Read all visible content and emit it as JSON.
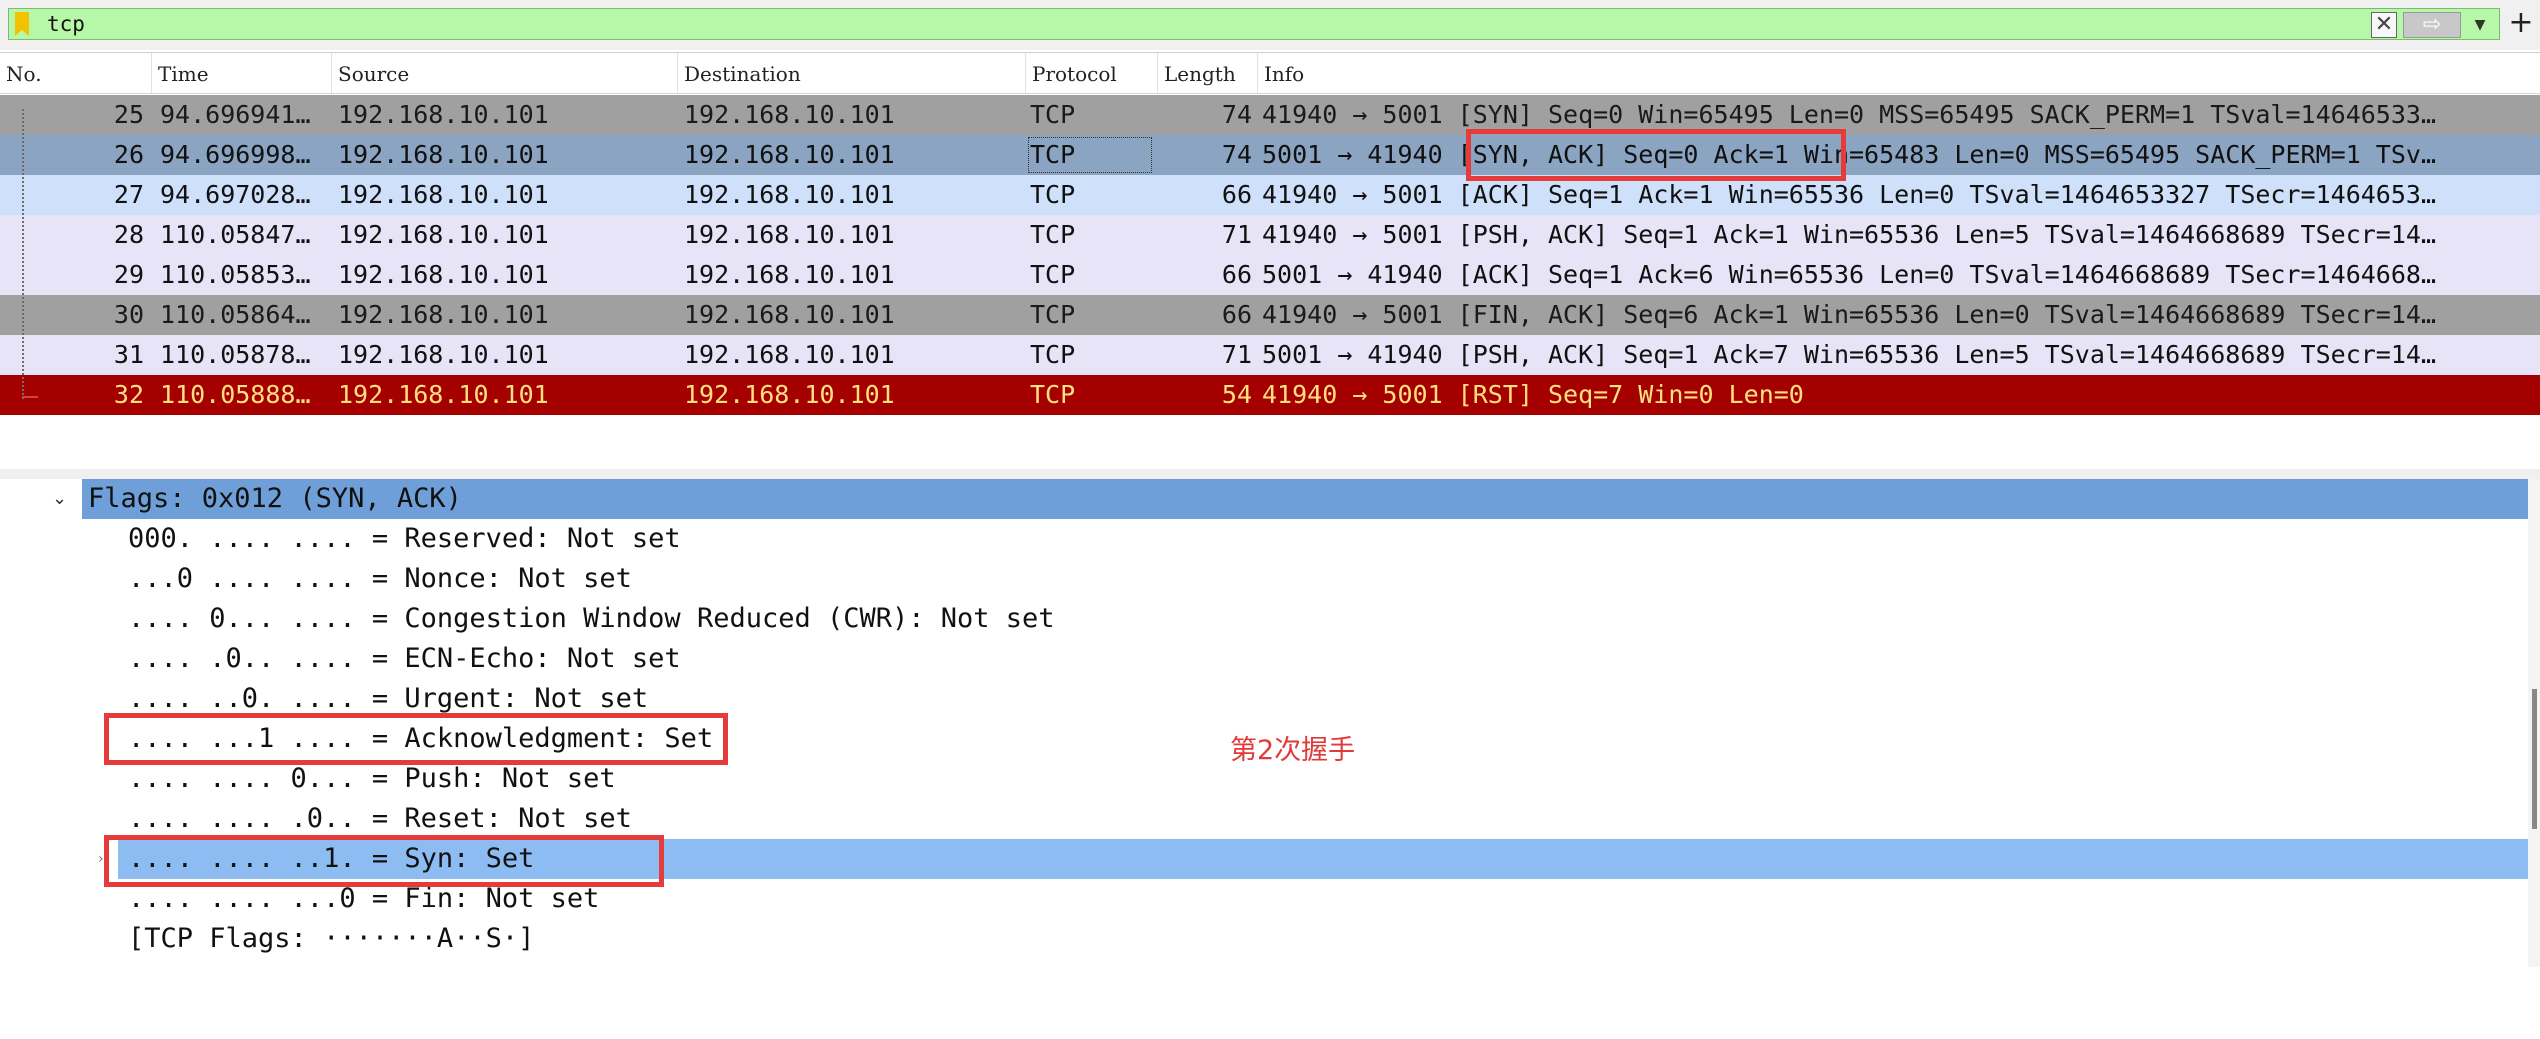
{
  "filter": {
    "value": "tcp",
    "clear_icon": "clear-icon",
    "apply_icon": "arrow-right-icon",
    "dropdown_icon": "chevron-down-icon",
    "add_icon": "plus-icon"
  },
  "columns": [
    "No.",
    "Time",
    "Source",
    "Destination",
    "Protocol",
    "Length",
    "Info"
  ],
  "packets": [
    {
      "no": "25",
      "time": "94.696941…",
      "src": "192.168.10.101",
      "dst": "192.168.10.101",
      "proto": "TCP",
      "len": "74",
      "info": "41940 → 5001 [SYN] Seq=0 Win=65495 Len=0 MSS=65495 SACK_PERM=1 TSval=14646533…"
    },
    {
      "no": "26",
      "time": "94.696998…",
      "src": "192.168.10.101",
      "dst": "192.168.10.101",
      "proto": "TCP",
      "len": "74",
      "info": "5001 → 41940 [SYN, ACK] Seq=0 Ack=1 Win=65483 Len=0 MSS=65495 SACK_PERM=1 TSv…"
    },
    {
      "no": "27",
      "time": "94.697028…",
      "src": "192.168.10.101",
      "dst": "192.168.10.101",
      "proto": "TCP",
      "len": "66",
      "info": "41940 → 5001 [ACK] Seq=1 Ack=1 Win=65536 Len=0 TSval=1464653327 TSecr=1464653…"
    },
    {
      "no": "28",
      "time": "110.05847…",
      "src": "192.168.10.101",
      "dst": "192.168.10.101",
      "proto": "TCP",
      "len": "71",
      "info": "41940 → 5001 [PSH, ACK] Seq=1 Ack=1 Win=65536 Len=5 TSval=1464668689 TSecr=14…"
    },
    {
      "no": "29",
      "time": "110.05853…",
      "src": "192.168.10.101",
      "dst": "192.168.10.101",
      "proto": "TCP",
      "len": "66",
      "info": "5001 → 41940 [ACK] Seq=1 Ack=6 Win=65536 Len=0 TSval=1464668689 TSecr=1464668…"
    },
    {
      "no": "30",
      "time": "110.05864…",
      "src": "192.168.10.101",
      "dst": "192.168.10.101",
      "proto": "TCP",
      "len": "66",
      "info": "41940 → 5001 [FIN, ACK] Seq=6 Ack=1 Win=65536 Len=0 TSval=1464668689 TSecr=14…"
    },
    {
      "no": "31",
      "time": "110.05878…",
      "src": "192.168.10.101",
      "dst": "192.168.10.101",
      "proto": "TCP",
      "len": "71",
      "info": "5001 → 41940 [PSH, ACK] Seq=1 Ack=7 Win=65536 Len=5 TSval=1464668689 TSecr=14…"
    },
    {
      "no": "32",
      "time": "110.05888…",
      "src": "192.168.10.101",
      "dst": "192.168.10.101",
      "proto": "TCP",
      "len": "54",
      "info": "41940 → 5001 [RST] Seq=7 Win=0 Len=0"
    }
  ],
  "row_colors": [
    {
      "bg": "#a0a0a0",
      "fg": "#1a1a1a"
    },
    {
      "bg": "#8aa4c2",
      "fg": "#111111"
    },
    {
      "bg": "#cfe0fb",
      "fg": "#111111"
    },
    {
      "bg": "#e8e4f8",
      "fg": "#111111"
    },
    {
      "bg": "#e8e4f8",
      "fg": "#111111"
    },
    {
      "bg": "#a0a0a0",
      "fg": "#1a1a1a"
    },
    {
      "bg": "#e8e4f8",
      "fg": "#111111"
    },
    {
      "bg": "#a40000",
      "fg": "#ffe080"
    }
  ],
  "details": {
    "flags_header": "Flags: 0x012 (SYN, ACK)",
    "lines": [
      "000. .... .... = Reserved: Not set",
      "...0 .... .... = Nonce: Not set",
      ".... 0... .... = Congestion Window Reduced (CWR): Not set",
      ".... .0.. .... = ECN-Echo: Not set",
      ".... ..0. .... = Urgent: Not set",
      ".... ...1 .... = Acknowledgment: Set",
      ".... .... 0... = Push: Not set",
      ".... .... .0.. = Reset: Not set",
      ".... .... ..1. = Syn: Set",
      ".... .... ...0 = Fin: Not set",
      "[TCP Flags: ·······A··S·]"
    ],
    "annotation": "第2次握手"
  },
  "colors": {
    "accent_red": "#e53b3b",
    "flags_header_bg": "#6f9fd8",
    "syn_selected_bg": "#8cbcf2",
    "filter_bg": "#b6f7a8"
  }
}
